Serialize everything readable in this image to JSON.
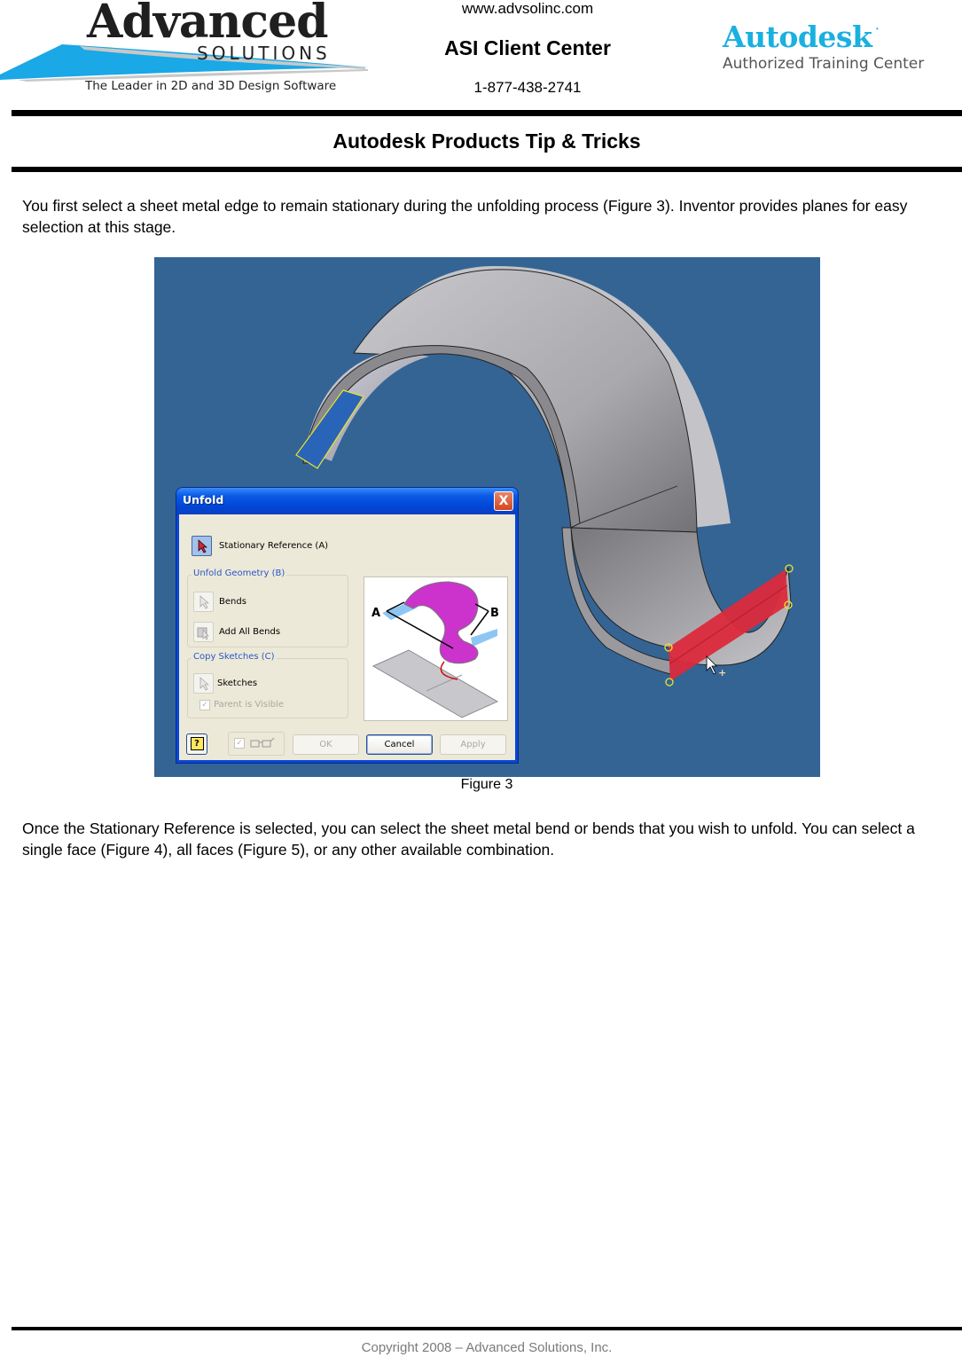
{
  "header": {
    "left_logo": {
      "brand": "Advanced",
      "sub": "SOLUTIONS",
      "tagline": "The Leader in 2D and 3D Design Software"
    },
    "website": "www.advsolinc.com",
    "center_name": "ASI Client Center",
    "phone": "1-877-438-2741",
    "right_logo": {
      "brand": "Autodesk",
      "reg_mark": "•",
      "sub": "Authorized Training Center"
    },
    "colors": {
      "autodesk_blue": "#1ab0e0",
      "swoosh_blue": "#1aa8e6"
    }
  },
  "document": {
    "title": "Autodesk Products Tip & Tricks",
    "paragraph_1": "You first select a sheet metal edge to remain stationary during the unfolding process (Figure 3).  Inventor provides planes for easy selection at this stage.",
    "figure_caption": "Figure 3",
    "paragraph_2": "Once the Stationary Reference is selected, you can select the sheet metal bend or bends that you wish to unfold.  You can select a single face (Figure 4), all faces (Figure 5), or any other available combination."
  },
  "figure": {
    "background_color": "#346494",
    "part_color": "#b8b8bc",
    "selected_face_color": "#dc2a3c",
    "dialog": {
      "title": "Unfold",
      "close_label": "X",
      "stationary_reference_label": "Stationary Reference (A)",
      "unfold_geometry_group": "Unfold Geometry (B)",
      "bends_label": "Bends",
      "add_all_bends_label": "Add All Bends",
      "copy_sketches_group": "Copy Sketches (C)",
      "sketches_label": "Sketches",
      "parent_visible_label": "Parent is Visible",
      "parent_visible_checked": true,
      "preview_checked": true,
      "preview_labels": {
        "a": "A",
        "b": "B"
      },
      "help_label": "?",
      "ok_label": "OK",
      "cancel_label": "Cancel",
      "apply_label": "Apply"
    }
  },
  "footer": {
    "copyright": "Copyright 2008 – Advanced Solutions, Inc."
  }
}
